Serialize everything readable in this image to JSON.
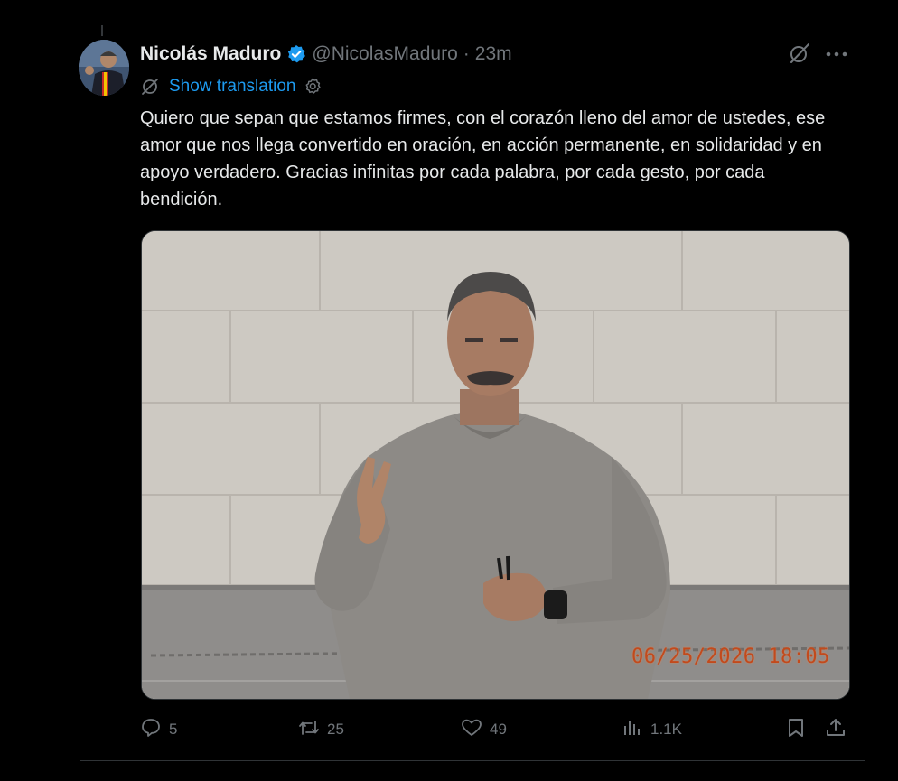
{
  "post": {
    "author_name": "Nicolás Maduro",
    "handle": "@NicolasMaduro",
    "separator": "·",
    "time_ago": "23m",
    "show_translation": "Show translation",
    "text": "Quiero que sepan que estamos firmes, con el corazón lleno del amor de ustedes, ese amor que nos llega convertido en oración, en acción permanente, en solidaridad y en apoyo verdadero. Gracias infinitas por cada palabra, por cada gesto, por cada bendición.",
    "media": {
      "timestamp_overlay": "06/25/2026  18:05"
    }
  },
  "actions": {
    "replies": "5",
    "reposts": "25",
    "likes": "49",
    "views": "1.1K"
  },
  "icons": {
    "verified": "verified-badge-icon",
    "grok": "grok-icon",
    "more": "more-icon",
    "translate": "translate-icon",
    "settings": "settings-icon",
    "reply": "reply-icon",
    "repost": "repost-icon",
    "like": "like-icon",
    "views": "views-icon",
    "bookmark": "bookmark-icon",
    "share": "share-icon"
  },
  "colors": {
    "background": "#000000",
    "text": "#e7e9ea",
    "muted": "#71767b",
    "accent": "#1d9bf0"
  }
}
